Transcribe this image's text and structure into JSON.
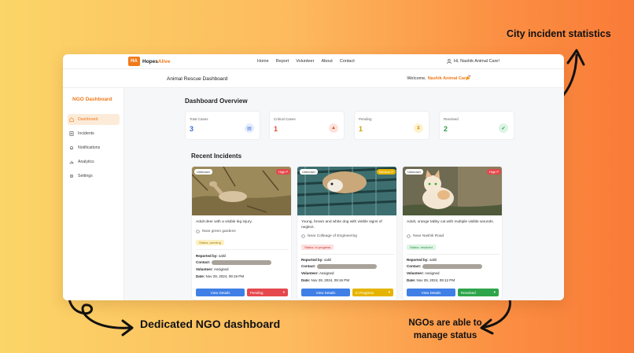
{
  "annotations": {
    "top_right": "City incident statistics",
    "bottom_left": "Dedicated NGO dashboard",
    "bottom_right": "NGOs are able to manage status"
  },
  "nav": {
    "logo_mark": "HA",
    "brand_primary": "Hopes",
    "brand_accent": "Alive",
    "links": [
      "Home",
      "Report",
      "Volunteer",
      "About",
      "Contact"
    ],
    "user": "Hi, Nashik Animal Care!"
  },
  "subheader": {
    "title": "Animal Rescue Dashboard",
    "welcome_prefix": "Welcome,",
    "welcome_name": "Nashik Animal Care!"
  },
  "sidebar": {
    "heading": "NGO Dashboard",
    "items": [
      {
        "label": "Dashboard",
        "icon": "home-icon",
        "active": true
      },
      {
        "label": "Incidents",
        "icon": "incidents-icon",
        "active": false
      },
      {
        "label": "Notifications",
        "icon": "bell-icon",
        "active": false
      },
      {
        "label": "Analytics",
        "icon": "analytics-icon",
        "active": false
      },
      {
        "label": "Settings",
        "icon": "gear-icon",
        "active": false
      }
    ]
  },
  "overview": {
    "title": "Dashboard Overview",
    "stats": [
      {
        "label": "Total Cases",
        "value": "3",
        "color": "#3b6fd6",
        "icon": "clipboard-icon"
      },
      {
        "label": "Critical Cases",
        "value": "1",
        "color": "#e04b2f",
        "icon": "alert-icon"
      },
      {
        "label": "Pending",
        "value": "1",
        "color": "#d49a0b",
        "icon": "hourglass-icon"
      },
      {
        "label": "Resolved",
        "value": "2",
        "color": "#2e9a4a",
        "icon": "check-icon"
      }
    ]
  },
  "recent": {
    "title": "Recent Incidents",
    "incidents": [
      {
        "animal_tag": "Unknown",
        "priority": "High P",
        "priority_color": "#e5484d",
        "description": "Adult deer with a visible leg injury.",
        "location": "Near green gardens",
        "status_text": "Status: pending",
        "status_bg": "#fdf0c2",
        "status_fg": "#9a7a10",
        "reported_by_label": "Reported by:",
        "reported_by": "sahil",
        "contact_label": "Contact:",
        "volunteer_label": "Volunteer:",
        "volunteer": "Assigned",
        "date_label": "Date:",
        "date": "Nov 29, 2024, 09:19 PM",
        "view_label": "View Details",
        "action_label": "Pending",
        "action_color": "#e5484d"
      },
      {
        "animal_tag": "Unknown",
        "priority": "Medium P",
        "priority_color": "#e6b400",
        "description": "Young, brown and white dog with visible signs of neglect.",
        "location": "Near Colleage of Engineering",
        "status_text": "Status: in progress",
        "status_bg": "#fde0e0",
        "status_fg": "#c0392b",
        "reported_by_label": "Reported by:",
        "reported_by": "sahil",
        "contact_label": "Contact:",
        "volunteer_label": "Volunteer:",
        "volunteer": "Assigned",
        "date_label": "Date:",
        "date": "Nov 29, 2024, 09:16 PM",
        "view_label": "View Details",
        "action_label": "In Progress",
        "action_color": "#e6b400"
      },
      {
        "animal_tag": "Unknown",
        "priority": "High P",
        "priority_color": "#e5484d",
        "description": "Adult, orange tabby cat with multiple visible wounds.",
        "location": "Near Nashik Road",
        "status_text": "Status: resolved",
        "status_bg": "#dcf5e3",
        "status_fg": "#2e8a47",
        "reported_by_label": "Reported by:",
        "reported_by": "sahil",
        "contact_label": "Contact:",
        "volunteer_label": "Volunteer:",
        "volunteer": "Assigned",
        "date_label": "Date:",
        "date": "Nov 29, 2024, 09:12 PM",
        "view_label": "View Details",
        "action_label": "Resolved",
        "action_color": "#2ea54a"
      }
    ]
  }
}
